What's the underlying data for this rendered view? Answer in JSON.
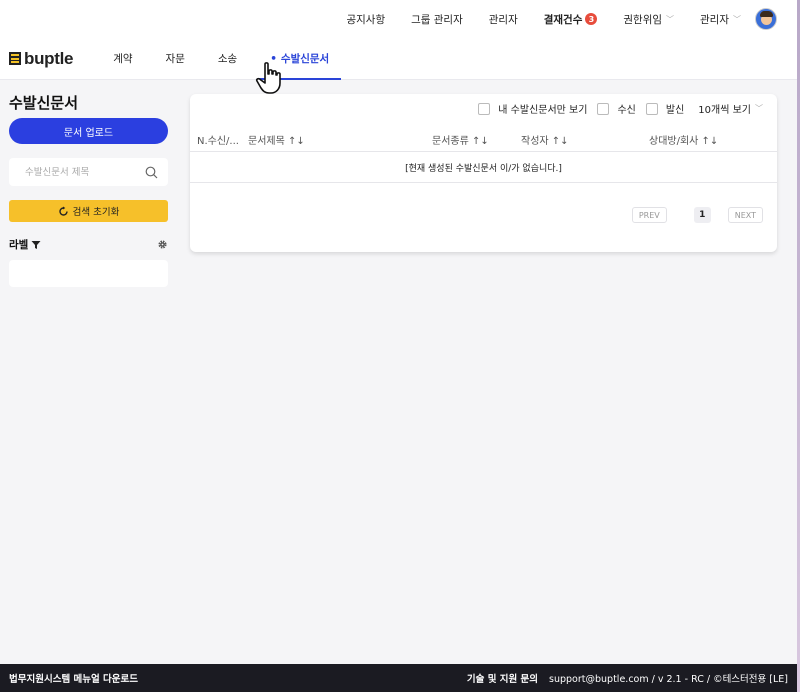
{
  "topbar": {
    "items": [
      "공지사항",
      "그룹 관리자",
      "관리자"
    ],
    "pending": {
      "label": "결재건수",
      "count": "3"
    },
    "delegation": "권한위임",
    "admin_menu": "관리자"
  },
  "brand": {
    "name": "buptle"
  },
  "nav": {
    "items": [
      "계약",
      "자문",
      "소송",
      "수발신문서"
    ],
    "active_index": 3
  },
  "sidebar": {
    "title": "수발신문서",
    "upload_label": "문서 업로드",
    "search_placeholder": "수발신문서 제목",
    "reset_label": "검색 초기화",
    "label_title": "라벨"
  },
  "main": {
    "filters": {
      "mine": "내 수발신문서만 보기",
      "received": "수신",
      "sent": "발신",
      "per_page": "10개씩 보기"
    },
    "columns": [
      "N.수신/...",
      "문서제목 ↑↓",
      "문서종류 ↑↓",
      "작성자 ↑↓",
      "상대방/회사 ↑↓"
    ],
    "empty_message": "[현재 생성된 수발신문서 이/가 없습니다.]",
    "pagination": {
      "prev": "PREV",
      "page": "1",
      "next": "NEXT"
    }
  },
  "footer": {
    "manual_link": "법무지원시스템 메뉴얼 다운로드",
    "support_title": "기술 및 지원 문의",
    "support_info": "support@buptle.com / v 2.1 - RC / ©테스터전용 [LE]"
  },
  "colors": {
    "primary": "#2b3fe0",
    "accent": "#f6c02a",
    "footer": "#1b1b22",
    "badge": "#e74c3c"
  }
}
